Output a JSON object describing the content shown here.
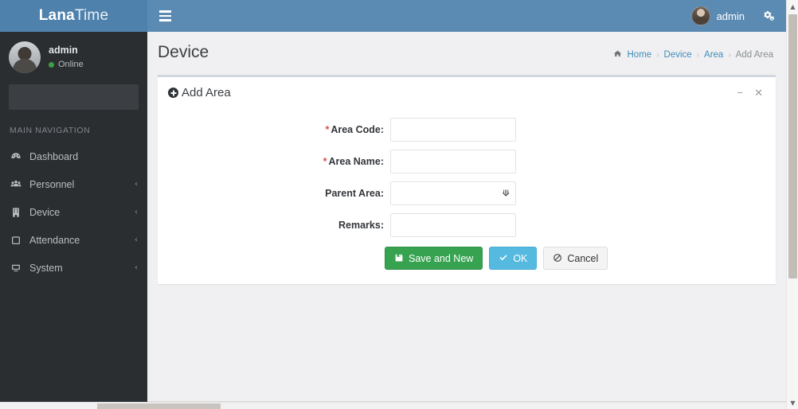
{
  "brand": {
    "name_bold": "Lana",
    "name_light": "Time"
  },
  "navbar": {
    "menu_toggle_icon": "hamburger-icon",
    "user_name": "admin",
    "settings_icon": "gears-icon"
  },
  "sidebar": {
    "user": {
      "name": "admin",
      "status": "Online"
    },
    "search": {
      "value": "",
      "placeholder": ""
    },
    "nav_header": "MAIN NAVIGATION",
    "items": [
      {
        "label": "Dashboard",
        "icon": "dashboard-icon",
        "caret": "",
        "active": false
      },
      {
        "label": "Personnel",
        "icon": "users-icon",
        "caret": "‹",
        "active": false
      },
      {
        "label": "Device",
        "icon": "building-icon",
        "caret": "‹",
        "active": false
      },
      {
        "label": "Attendance",
        "icon": "calendar-icon",
        "caret": "‹",
        "active": false
      },
      {
        "label": "System",
        "icon": "desktop-icon",
        "caret": "‹",
        "active": false
      }
    ]
  },
  "content": {
    "page_title": "Device",
    "breadcrumb": {
      "home_icon": "home-icon",
      "items": [
        "Home",
        "Device",
        "Area",
        "Add Area"
      ],
      "separator": "›",
      "active_index": 3
    },
    "box": {
      "title": "Add Area",
      "title_icon": "plus-circle-icon",
      "minimize_icon": "−",
      "close_icon": "✕",
      "form": {
        "fields": [
          {
            "label": "Area Code:",
            "required": true,
            "type": "text",
            "value": "",
            "placeholder": ""
          },
          {
            "label": "Area Name:",
            "required": true,
            "type": "text",
            "value": "",
            "placeholder": ""
          },
          {
            "label": "Parent Area:",
            "required": false,
            "type": "select",
            "value": "",
            "placeholder": "",
            "options": [
              ""
            ]
          },
          {
            "label": "Remarks:",
            "required": false,
            "type": "text",
            "value": "",
            "placeholder": ""
          }
        ],
        "buttons": [
          {
            "label": "Save and New",
            "style": "success",
            "icon": "save-icon"
          },
          {
            "label": "OK",
            "style": "info",
            "icon": "check-icon"
          },
          {
            "label": "Cancel",
            "style": "default",
            "icon": "ban-icon"
          }
        ]
      }
    }
  },
  "colors": {
    "brand_blue": "#4e81ab",
    "navbar_blue": "#5b8bb3",
    "sidebar_dark": "#2b2e31",
    "content_bg": "#f0f0f2",
    "link_blue": "#3c8dbc",
    "success_green": "#37a350",
    "info_blue": "#56b9e0",
    "required_red": "#d9534f",
    "online_green": "#3d9e46"
  }
}
